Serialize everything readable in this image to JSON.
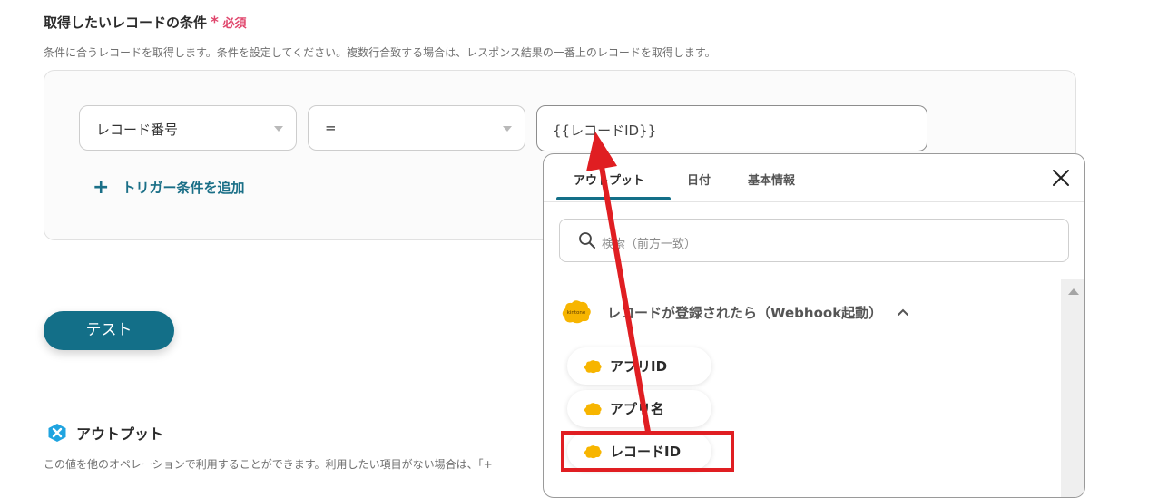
{
  "section": {
    "title": "取得したいレコードの条件",
    "required_star": "*",
    "required_label": "必須",
    "description": "条件に合うレコードを取得します。条件を設定してください。複数行合致する場合は、レスポンス結果の一番上のレコードを取得します。"
  },
  "condition": {
    "field_value": "レコード番号",
    "operator_value": "=",
    "value_input": "{{レコードID}}",
    "add_label": "トリガー条件を追加",
    "add_icon": "+"
  },
  "test_button": "テスト",
  "output": {
    "title": "アウトプット",
    "description": "この値を他のオペレーションで利用することができます。利用したい項目がない場合は、「+"
  },
  "panel": {
    "tabs": [
      {
        "label": "アウトプット",
        "active": true
      },
      {
        "label": "日付",
        "active": false
      },
      {
        "label": "基本情報",
        "active": false
      }
    ],
    "search_placeholder": "検索（前方一致）",
    "group_title": "レコードが登録されたら（Webhook起動）",
    "logo_text": "kintone",
    "items": [
      {
        "label": "アプリID"
      },
      {
        "label": "アプリ名"
      },
      {
        "label": "レコードID"
      }
    ]
  },
  "colors": {
    "accent": "#136f88",
    "required": "#e0466c",
    "annotation_red": "#e01e22",
    "kintone_yellow": "#f7b500"
  }
}
